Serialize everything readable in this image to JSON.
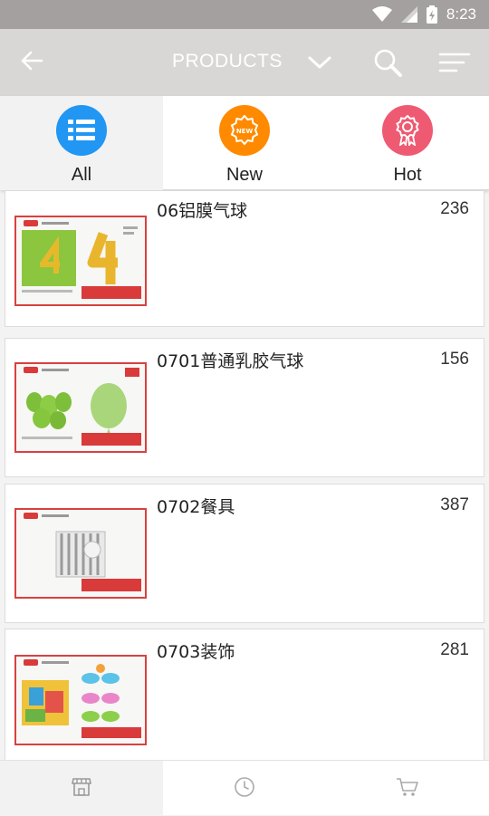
{
  "status_bar": {
    "time": "8:23",
    "icons": [
      "wifi-icon",
      "signal-icon",
      "battery-icon"
    ]
  },
  "header": {
    "title": "PRODUCTS",
    "icons": [
      "back-arrow-icon",
      "chevron-down-icon",
      "search-icon",
      "sort-icon"
    ],
    "text_color": "#ffffff",
    "background": "#d9d7d6"
  },
  "tabs": [
    {
      "label": "All",
      "icon": "list-icon",
      "color": "#2196f3",
      "active": true
    },
    {
      "label": "New",
      "icon": "new-badge-icon",
      "color": "#ff8a00",
      "active": false
    },
    {
      "label": "Hot",
      "icon": "award-ribbon-icon",
      "color": "#ef5a73",
      "active": false
    }
  ],
  "products": [
    {
      "name": "06铝膜气球",
      "count": "236"
    },
    {
      "name": "0701普通乳胶气球",
      "count": "156"
    },
    {
      "name": "0702餐具",
      "count": "387"
    },
    {
      "name": "0703装饰",
      "count": "281"
    }
  ],
  "bottom_nav": [
    {
      "icon": "store-icon",
      "active": true
    },
    {
      "icon": "clock-icon",
      "active": false
    },
    {
      "icon": "cart-icon",
      "active": false
    }
  ]
}
